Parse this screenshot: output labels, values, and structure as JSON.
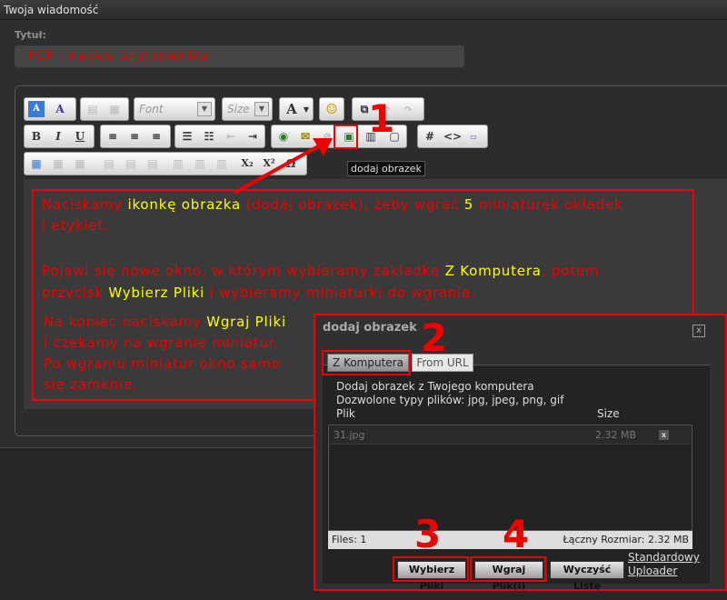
{
  "window": {
    "title": "Twoja wiadomość"
  },
  "form": {
    "title_label": "Tytuł:",
    "title_value": "PCP - nazwa użytkownika"
  },
  "toolbar": {
    "font_placeholder": "Font",
    "size_placeholder": "Size",
    "tooltip": "dodaj obrazek",
    "hash_label": "#",
    "subscript_label": "X₂",
    "superscript_label": "X²"
  },
  "annotations": {
    "step1": "1",
    "step2": "2",
    "step3": "3",
    "step4": "4",
    "p1_a": "Naciskamy ",
    "p1_b": "ikonkę obrazka",
    "p1_c": " (dodaj obrazek), żeby wgrać ",
    "p1_d": "5",
    "p1_e": " miniaturek okładek",
    "p1_line2": "i etykiet.",
    "p2_a": "Pojawi się nowe okno, w którym wybieramy zakładkę ",
    "p2_b": "Z Komputera",
    "p2_c": ", potem",
    "p2_d": "przycisk ",
    "p2_e": "Wybierz Pliki",
    "p2_f": " i wybieramy miniaturki do wgrania.",
    "p3_a": "Na koniec naciskamy ",
    "p3_b": "Wgraj Pliki",
    "p3_line2": "i czekamy na wgranie miniatur.",
    "p3_line3": "Po wgraniu miniatur okno samo",
    "p3_line4": "się zamknie."
  },
  "dialog": {
    "title": "dodaj obrazek",
    "close": "x",
    "tabs": [
      {
        "label": "Z Komputera"
      },
      {
        "label": "From URL"
      }
    ],
    "line1": "Dodaj obrazek z Twojego komputera",
    "line2": "Dozwolone typy plików: jpg, jpeg, png, gif",
    "col_file": "Plik",
    "col_size": "Size",
    "files": [
      {
        "name": "31.jpg",
        "size": "2.32 MB"
      }
    ],
    "remove_label": "x",
    "files_count": "Files: 1",
    "total_size": "Łączny Rozmiar: 2.32 MB",
    "choose_button": "Wybierz Pliki",
    "upload_button": "Wgraj Plik(i)",
    "clear_button": "Wyczyść Listę",
    "link_standard": "Standardowy",
    "link_uploader": "Uploader"
  },
  "colors": {
    "annotation_red": "#ee0000",
    "highlight_yellow": "#ffff00"
  }
}
